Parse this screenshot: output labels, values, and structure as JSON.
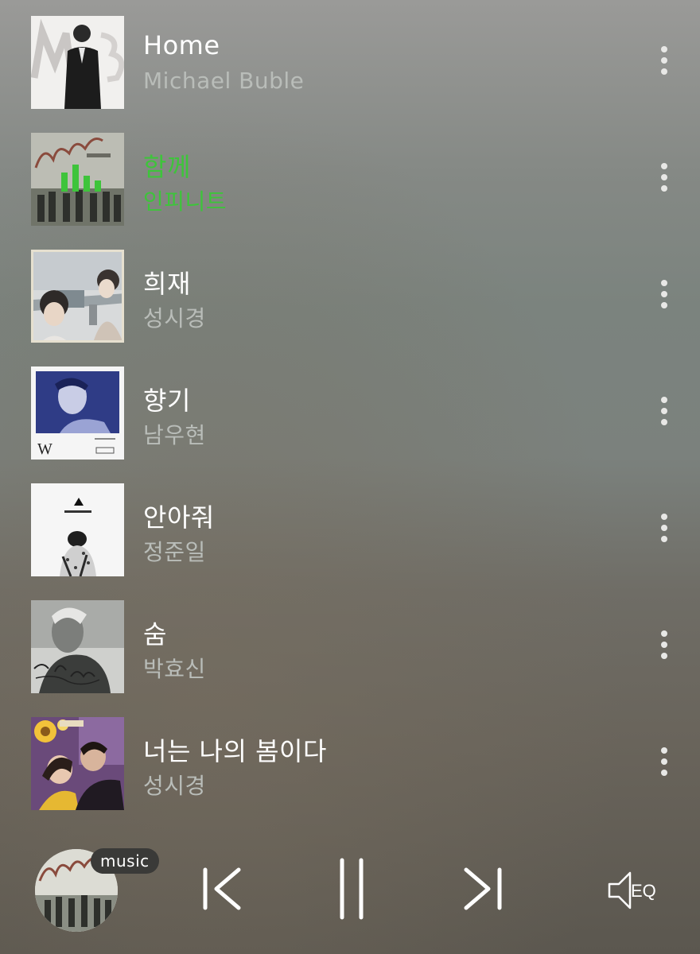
{
  "tracks": [
    {
      "title": "Home",
      "artist": "Michael Buble",
      "playing": false,
      "cover_icon": "album-cover-michael-buble"
    },
    {
      "title": "함께",
      "artist": "인피니트",
      "playing": true,
      "cover_icon": "album-cover-infinite-grow"
    },
    {
      "title": "희재",
      "artist": "성시경",
      "playing": false,
      "cover_icon": "album-cover-heejae"
    },
    {
      "title": "향기",
      "artist": "남우현",
      "playing": false,
      "cover_icon": "album-cover-namwoohyun-w"
    },
    {
      "title": "안아줘",
      "artist": "정준일",
      "playing": false,
      "cover_icon": "album-cover-lovers"
    },
    {
      "title": "숨",
      "artist": "박효신",
      "playing": false,
      "cover_icon": "album-cover-i-am-a-dreamer"
    },
    {
      "title": "너는 나의 봄이다",
      "artist": "성시경",
      "playing": false,
      "cover_icon": "album-cover-spring"
    }
  ],
  "player": {
    "badge": "music",
    "eq_label": "EQ",
    "state": "playing"
  },
  "colors": {
    "accent": "#3ec43b",
    "title_text": "#ffffff",
    "artist_text": "#b9bdb9"
  }
}
